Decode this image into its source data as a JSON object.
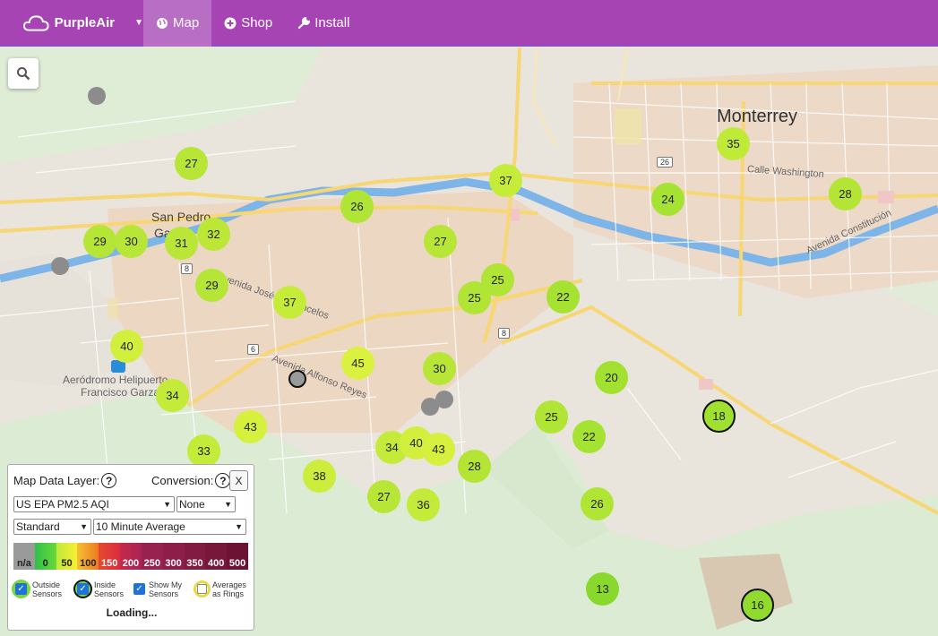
{
  "nav": {
    "brand": "PurpleAir",
    "items": [
      {
        "label": "Map",
        "icon": "globe-icon",
        "active": true
      },
      {
        "label": "Shop",
        "icon": "plus-circle-icon",
        "active": false
      },
      {
        "label": "Install",
        "icon": "wrench-icon",
        "active": false
      }
    ]
  },
  "map": {
    "labels": {
      "city": "Monterrey",
      "san_pedro_1": "San Pedro",
      "san_pedro_2": "Garza",
      "aero_1": "Aeródromo Helipuerto",
      "aero_2": "Francisco Garza",
      "calle_washington": "Calle Washington",
      "avenida_constitucion": "Avenida Constitución",
      "jose_vasconcelos": "Avenida José Vasconcelos",
      "alfonso_reyes": "Avenida Alfonso Reyes"
    },
    "shields": [
      "26",
      "8",
      "6",
      "8"
    ],
    "sensors": [
      "27",
      "26",
      "37",
      "35",
      "24",
      "28",
      "29",
      "30",
      "31",
      "32",
      "27",
      "29",
      "37",
      "25",
      "25",
      "22",
      "40",
      "45",
      "30",
      "20",
      "18",
      "34",
      "43",
      "33",
      "25",
      "22",
      "34",
      "40",
      "43",
      "28",
      "38",
      "27",
      "36",
      "26",
      "13",
      "16"
    ]
  },
  "panel": {
    "map_layer_label": "Map Data Layer:",
    "conversion_label": "Conversion:",
    "help": "?",
    "close": "X",
    "layer_value": "US EPA PM2.5 AQI",
    "conversion_value": "None",
    "style_value": "Standard",
    "average_value": "10 Minute Average",
    "scale": [
      "n/a",
      "0",
      "50",
      "100",
      "150",
      "200",
      "250",
      "300",
      "350",
      "400",
      "500"
    ],
    "scale_colors": [
      "#9a9a9a",
      "#3dc43d",
      "#f3ef2f",
      "#f2871f",
      "#e0343a",
      "#b32a55",
      "#9a2250",
      "#8c1d49",
      "#7f1a3f",
      "#741538",
      "#6a1131"
    ],
    "checks": {
      "outside": "Outside Sensors",
      "inside": "Inside Sensors",
      "mine": "Show My Sensors",
      "rings": "Averages as Rings"
    },
    "status": "Loading..."
  },
  "colors": {
    "nav": "#a644b3",
    "nav_active": "#b86ec4",
    "green": "#8ddc2f",
    "yellow_green": "#c4ec3a",
    "yellow": "#dcef3c"
  }
}
